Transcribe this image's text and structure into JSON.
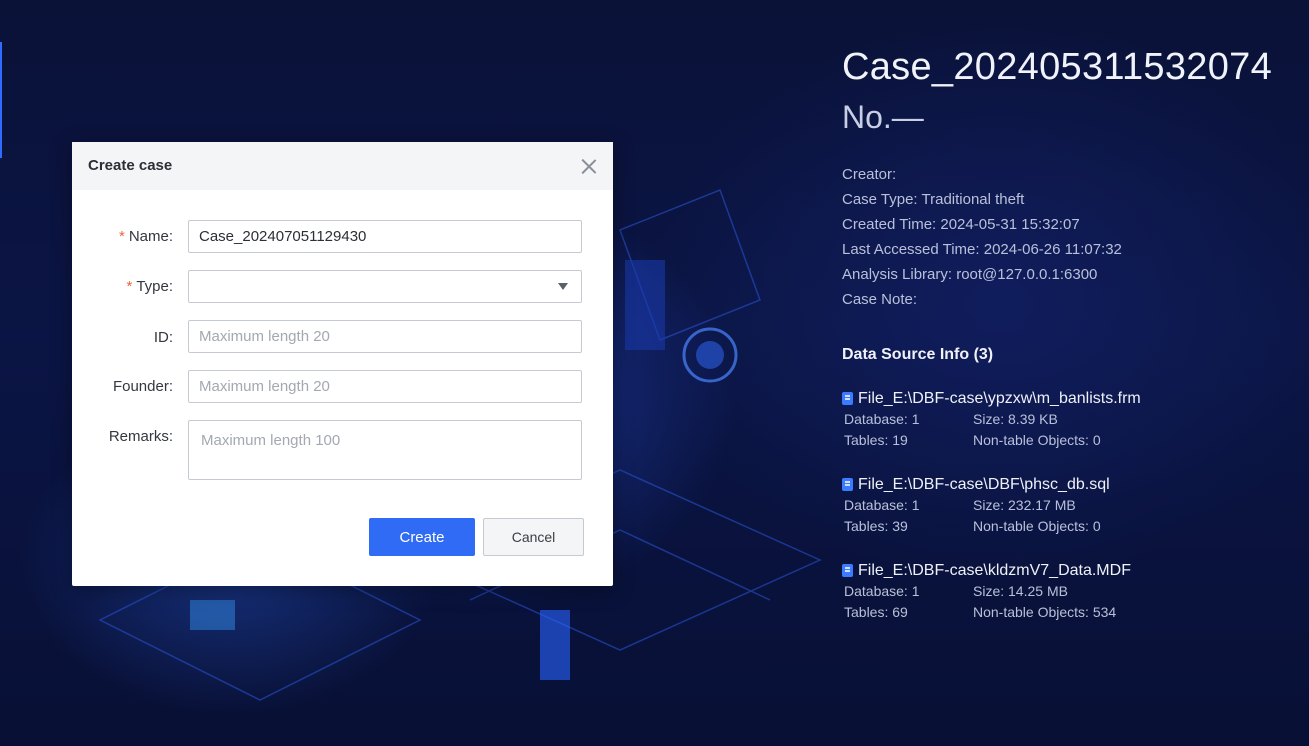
{
  "case": {
    "title": "Case_202405311532074",
    "number": "No.—",
    "creator": "Creator:",
    "case_type": "Case Type: Traditional theft",
    "created_time": "Created Time: 2024-05-31 15:32:07",
    "last_accessed": "Last Accessed Time: 2024-06-26 11:07:32",
    "analysis_library": "Analysis Library: root@127.0.0.1:6300",
    "case_note": "Case Note:"
  },
  "data_sources": {
    "heading": "Data Source Info (3)",
    "items": [
      {
        "name": "File_E:\\DBF-case\\ypzxw\\m_banlists.frm",
        "database": "Database: 1",
        "size": "Size: 8.39 KB",
        "tables": "Tables: 19",
        "non_table": "Non-table Objects: 0"
      },
      {
        "name": "File_E:\\DBF-case\\DBF\\phsc_db.sql",
        "database": "Database: 1",
        "size": "Size: 232.17 MB",
        "tables": "Tables: 39",
        "non_table": "Non-table Objects: 0"
      },
      {
        "name": "File_E:\\DBF-case\\kldzmV7_Data.MDF",
        "database": "Database: 1",
        "size": "Size: 14.25 MB",
        "tables": "Tables: 69",
        "non_table": "Non-table Objects: 534"
      }
    ]
  },
  "dialog": {
    "title": "Create case",
    "required_mark": "*",
    "name_label": "Name:",
    "name_value": "Case_202407051129430",
    "type_label": "Type:",
    "type_value": "",
    "id_label": "ID:",
    "id_placeholder": "Maximum length 20",
    "founder_label": "Founder:",
    "founder_placeholder": "Maximum length 20",
    "remarks_label": "Remarks:",
    "remarks_placeholder": "Maximum length 100",
    "create_label": "Create",
    "cancel_label": "Cancel"
  },
  "colors": {
    "accent": "#2f6bf5",
    "required": "#e8663d",
    "background": "#070d2c"
  }
}
